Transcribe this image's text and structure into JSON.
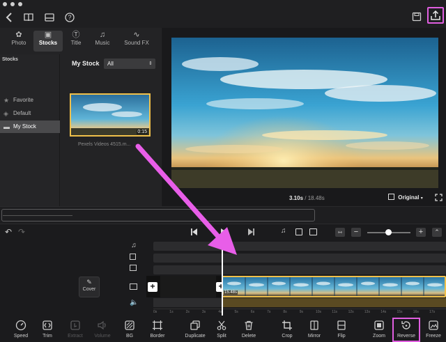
{
  "window": {
    "traffic_lights": [
      "close",
      "minimize",
      "zoom"
    ]
  },
  "topbar": {
    "icons": [
      "back-icon",
      "book-icon",
      "media-icon",
      "help-icon",
      "save-icon",
      "export-icon"
    ]
  },
  "tabs": [
    {
      "label": "Photo",
      "icon": "photo-icon"
    },
    {
      "label": "Stocks",
      "icon": "stocks-icon",
      "active": true
    },
    {
      "label": "Title",
      "icon": "title-icon"
    },
    {
      "label": "Music",
      "icon": "music-icon"
    },
    {
      "label": "Sound FX",
      "icon": "soundfx-icon"
    }
  ],
  "stocks_sidebar": {
    "heading": "Stocks",
    "items": [
      {
        "label": "Favorite",
        "icon": "star-icon"
      },
      {
        "label": "Default",
        "icon": "box-icon"
      },
      {
        "label": "My Stock",
        "icon": "folder-icon",
        "active": true
      }
    ]
  },
  "stock_area": {
    "title": "My Stock",
    "filter_value": "All",
    "clip": {
      "duration": "0:15",
      "name": "Pexels Videos 4515.m..."
    }
  },
  "preview": {
    "time_current": "3.10s",
    "time_total": "18.48s",
    "ratio_label": "Original"
  },
  "timeline": {
    "clip_badge": "15.48s",
    "cover_label": "Cover",
    "ruler_labels": [
      "0s",
      "1s",
      "2s",
      "3s",
      "4s",
      "5s",
      "6s",
      "7s",
      "8s",
      "9s",
      "10s",
      "11s",
      "12s",
      "13s",
      "14s",
      "15s",
      "16s",
      "17s"
    ]
  },
  "toolbar": {
    "items": [
      {
        "label": "Speed",
        "icon": "speed-icon"
      },
      {
        "label": "Trim",
        "icon": "trim-icon"
      },
      {
        "label": "Extract",
        "icon": "extract-icon",
        "disabled": true
      },
      {
        "label": "Volume",
        "icon": "volume-icon",
        "disabled": true
      },
      {
        "label": "BG",
        "icon": "bg-icon"
      },
      {
        "label": "Border",
        "icon": "border-icon"
      },
      {
        "label": "Duplicate",
        "icon": "duplicate-icon"
      },
      {
        "label": "Split",
        "icon": "split-icon"
      },
      {
        "label": "Delete",
        "icon": "delete-icon"
      },
      {
        "label": "Crop",
        "icon": "crop-icon"
      },
      {
        "label": "Mirror",
        "icon": "mirror-icon"
      },
      {
        "label": "Flip",
        "icon": "flip-icon"
      },
      {
        "label": "Zoom",
        "icon": "zoom-icon"
      },
      {
        "label": "Reverse",
        "icon": "reverse-icon",
        "highlighted": true
      },
      {
        "label": "Freeze",
        "icon": "freeze-icon"
      }
    ]
  },
  "colors": {
    "highlight": "#e05ee0",
    "accent": "#f0c04a",
    "playhead": "#ffffff"
  }
}
